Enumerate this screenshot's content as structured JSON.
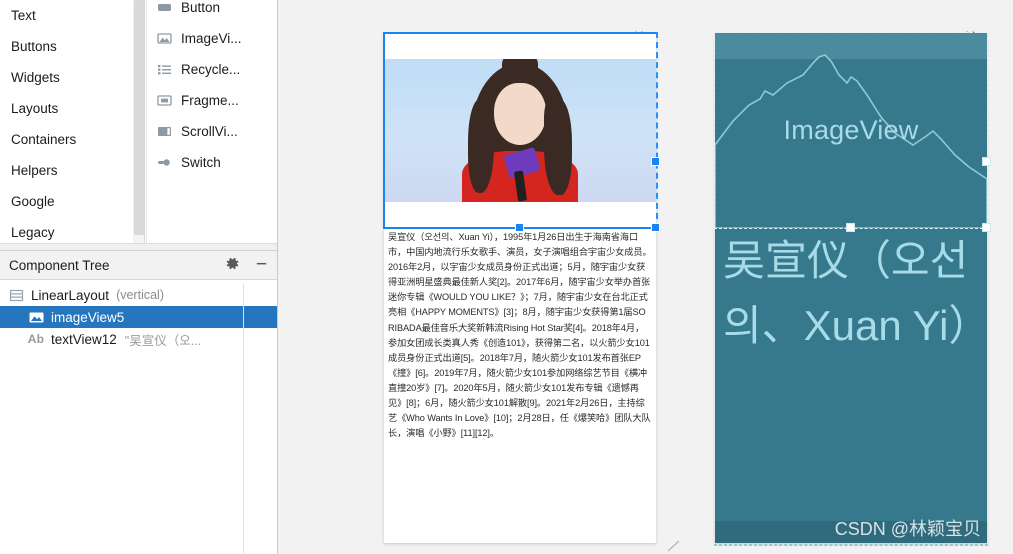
{
  "palette": {
    "categories": [
      {
        "label": "Text"
      },
      {
        "label": "Buttons"
      },
      {
        "label": "Widgets"
      },
      {
        "label": "Layouts"
      },
      {
        "label": "Containers"
      },
      {
        "label": "Helpers"
      },
      {
        "label": "Google"
      },
      {
        "label": "Legacy"
      }
    ],
    "widgets": [
      {
        "label": "Button",
        "icon": "button-icon"
      },
      {
        "label": "ImageVi...",
        "icon": "imageview-icon"
      },
      {
        "label": "Recycle...",
        "icon": "recyclerview-icon"
      },
      {
        "label": "Fragme...",
        "icon": "fragment-icon"
      },
      {
        "label": "ScrollVi...",
        "icon": "scrollview-icon"
      },
      {
        "label": "Switch",
        "icon": "switch-icon"
      }
    ]
  },
  "component_tree": {
    "title": "Component Tree",
    "gear_icon": "gear-icon",
    "minimize_icon": "minimize-icon",
    "rows": [
      {
        "name": "LinearLayout",
        "meta": "(vertical)",
        "icon": "linearlayout-icon",
        "depth": 0,
        "selected": false,
        "value": ""
      },
      {
        "name": "imageView5",
        "meta": "",
        "icon": "imageview-icon",
        "depth": 1,
        "selected": true,
        "value": ""
      },
      {
        "name": "textView12",
        "meta": "",
        "icon": "ab-icon",
        "depth": 1,
        "selected": false,
        "value": "\"吴宣仪（오..."
      }
    ]
  },
  "canvas": {
    "design": {
      "tool_icon": "wrench-icon",
      "body_text": "吴宣仪（오선의、Xuan Yi），1995年1月26日出生于海南省海口市，中国内地流行乐女歌手、演员，女子演唱组合宇宙少女成员。2016年2月，以宇宙少女成员身份正式出道；5月，随宇宙少女获得亚洲明星盛典最佳新人奖[2]。2017年6月，随宇宙少女举办首张迷你专辑《WOULD YOU LIKE？》；7月，随宇宙少女在台北正式亮相《HAPPY MOMENTS》[3]；8月，随宇宙少女获得第1届SORIBADA最佳音乐大奖新韩流Rising Hot Star奖[4]。2018年4月，参加女团成长类真人秀《创造101》，获得第二名，以火箭少女101成员身份正式出道[5]。2018年7月，随火箭少女101发布首张EP《撞》[6]。2019年7月，随火箭少女101参加网络综艺节目《横冲直撞20岁》[7]。2020年5月，随火箭少女101发布专辑《遗憾再见》[8]；6月，随火箭少女101解散[9]。2021年2月26日，主持综艺《Who Wants In Love》[10]；2月28日，任《爆笑哈》团队大队长，演唱《小野》[11][12]。"
    },
    "blueprint": {
      "tool_icon": "wrench-icon",
      "image_label": "ImageView",
      "text": "吴宣仪（오선의、Xuan Yi）"
    },
    "watermark": "CSDN @林颖宝贝"
  },
  "colors": {
    "selection_blue": "#2675bf",
    "handle_blue": "#1a85f0",
    "blueprint_teal": "#36788c",
    "blueprint_text": "#a7dbe8"
  }
}
